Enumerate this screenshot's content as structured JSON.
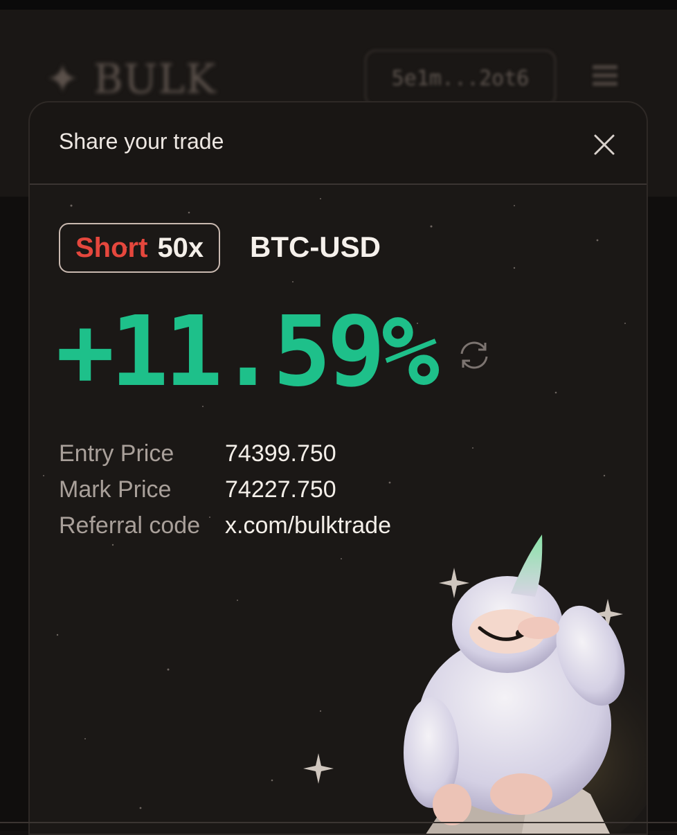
{
  "background": {
    "logo_text": "BULK",
    "wallet_text": "5e1m...2ot6"
  },
  "modal": {
    "title": "Share your trade"
  },
  "trade": {
    "side": "Short",
    "leverage": "50x",
    "pair": "BTC-USD",
    "pnl_percent": "+11.59%",
    "details": [
      {
        "label": "Entry Price",
        "value": "74399.750"
      },
      {
        "label": "Mark Price",
        "value": "74227.750"
      },
      {
        "label": "Referral code",
        "value": "x.com/bulktrade"
      }
    ]
  },
  "colors": {
    "short": "#e5473d",
    "pnl": "#1ec08a",
    "background": "#141110"
  },
  "icons": [
    "close-icon",
    "refresh-icon",
    "menu-icon",
    "sparkle-icon"
  ]
}
